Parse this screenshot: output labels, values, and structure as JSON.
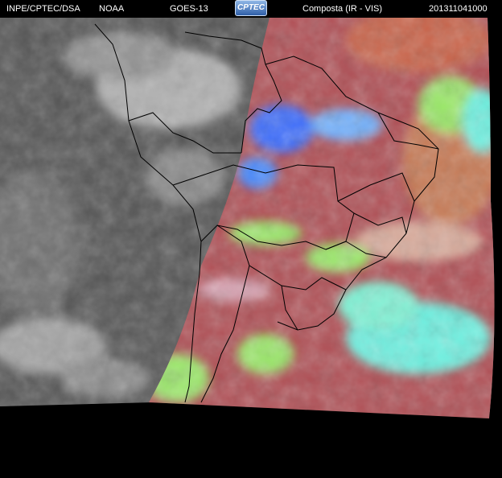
{
  "header": {
    "org": "INPE/CPTEC/DSA",
    "agency": "NOAA",
    "satellite": "GOES-13",
    "logo_text": "CPTEC",
    "product": "Composta (IR - VIS)",
    "timestamp": "201311041000"
  },
  "colors": {
    "background": "#000000",
    "vis_gray": "#5a5a5a",
    "ir_red": "#b24f55",
    "cloud_green": "#9be86a",
    "cloud_cyan": "#6ef0e0",
    "cold_blue": "#3a6cff",
    "boundary_line": "#000000"
  }
}
